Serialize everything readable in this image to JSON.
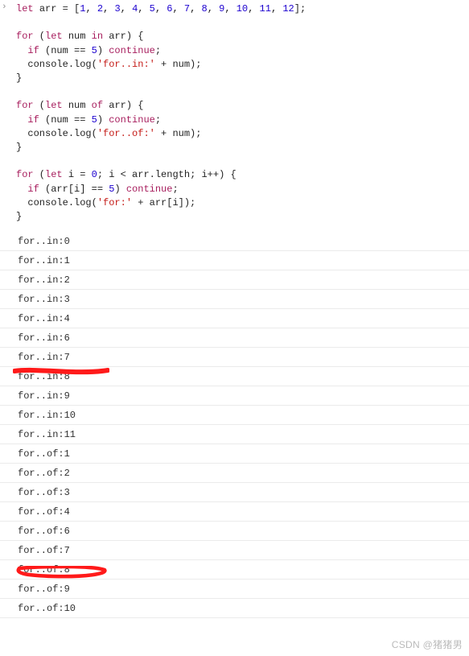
{
  "gutter_glyph": "›",
  "code": {
    "l1": {
      "let": "let",
      "arr": "arr",
      "eq": " = [",
      "n1": "1",
      "c": ", ",
      "n2": "2",
      "n3": "3",
      "n4": "4",
      "n5": "5",
      "n6": "6",
      "n7": "7",
      "n8": "8",
      "n9": "9",
      "n10": "10",
      "n11": "11",
      "n12": "12",
      "end": "];"
    },
    "l3": {
      "for": "for",
      "open": " (",
      "let": "let",
      "num": " num ",
      "in": "in",
      "arr": " arr) {"
    },
    "l4": {
      "indent": "  ",
      "if": "if",
      "open": " (num == ",
      "five": "5",
      "close": ") ",
      "cont": "continue",
      "semi": ";"
    },
    "l5": {
      "indent": "  ",
      "call": "console.log(",
      "str": "'for..in:'",
      "plus": " + num);"
    },
    "l6": {
      "close": "}"
    },
    "l8": {
      "for": "for",
      "open": " (",
      "let": "let",
      "num": " num ",
      "of": "of",
      "arr": " arr) {"
    },
    "l9": {
      "indent": "  ",
      "if": "if",
      "open": " (num == ",
      "five": "5",
      "close": ") ",
      "cont": "continue",
      "semi": ";"
    },
    "l10": {
      "indent": "  ",
      "call": "console.log(",
      "str": "'for..of:'",
      "plus": " + num);"
    },
    "l11": {
      "close": "}"
    },
    "l13": {
      "for": "for",
      "open": " (",
      "let": "let",
      "i": " i = ",
      "zero": "0",
      "mid": "; i < arr.length; i++) {"
    },
    "l14": {
      "indent": "  ",
      "if": "if",
      "open": " (arr[i] == ",
      "five": "5",
      "close": ") ",
      "cont": "continue",
      "semi": ";"
    },
    "l15": {
      "indent": "  ",
      "call": "console.log(",
      "str": "'for:'",
      "plus": " + arr[i]);"
    },
    "l16": {
      "close": "}"
    }
  },
  "output": [
    "for..in:0",
    "for..in:1",
    "for..in:2",
    "for..in:3",
    "for..in:4",
    "for..in:6",
    "for..in:7",
    "for..in:8",
    "for..in:9",
    "for..in:10",
    "for..in:11",
    "for..of:1",
    "for..of:2",
    "for..of:3",
    "for..of:4",
    "for..of:6",
    "for..of:7",
    "for..of:8",
    "for..of:9",
    "for..of:10"
  ],
  "watermark": "CSDN @猪猪男"
}
